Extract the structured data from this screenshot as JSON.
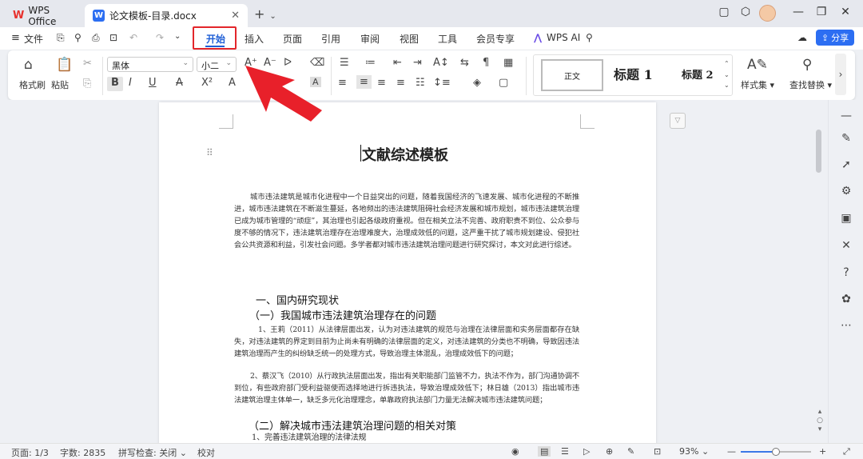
{
  "tabs": {
    "wps_label": "WPS Office",
    "doc_label": "论文模板-目录.docx",
    "new_tab": "+"
  },
  "menu": {
    "file": "文件",
    "items": [
      "开始",
      "插入",
      "页面",
      "引用",
      "审阅",
      "视图",
      "工具",
      "会员专享"
    ],
    "active_index": 0,
    "ai": "WPS AI",
    "share": "分享"
  },
  "ribbon": {
    "format_painter": "格式刷",
    "paste": "粘贴",
    "font_name": "黑体",
    "font_size": "小二",
    "style_normal": "正文",
    "style_h1": "标题 1",
    "style_h2": "标题 2",
    "style_set": "样式集",
    "find_replace": "查找替换"
  },
  "document": {
    "title": "文献综述模板",
    "intro": "城市违法建筑是城市化进程中一个日益突出的问题，随着我国经济的飞速发展、城市化进程的不断推进，城市违法建筑在不断滋生蔓延，各地频出的违法建筑阻碍社会经济发展和城市规划，城市违法建筑治理已成为城市管理的“顽症”，其治理也引起各级政府重视。但在相关立法不完善、政府职责不到位、公众参与度不够的情况下，违法建筑治理存在治理难度大，治理成效低的问题，这严重干扰了城市规划建设、侵犯社会公共资源和利益，引发社会问题。多学者都对城市违法建筑治理问题进行研究探讨，本文对此进行综述。",
    "section1": "一、国内研究现状",
    "sub1": "（一）我国城市违法建筑治理存在的问题",
    "item1": "1、王莉（2011）从法律层面出发，认为对违法建筑的规范与治理在法律层面和实务层面都存在缺失，对违法建筑的界定到目前为止尚未有明确的法律层面的定义，对违法建筑的分类也不明确，导致因违法建筑治理而产生的纠纷缺乏统一的处理方式，导致治理主体混乱，治理成效低下的问题；",
    "item2": "2、蔡汉飞（2010）从行政执法层面出发，指出有关职能部门监管不力，执法不作为，部门沟通协调不到位，有些政府部门受利益驱使而选择地进行拆违执法，导致治理成效低下；林日雄（2013）指出城市违法建筑治理主体单一，缺乏多元化治理理念，单靠政府执法部门力量无法解决城市违法建筑问题；",
    "sub2": "（二）解决城市违法建筑治理问题的相关对策",
    "item3": "1、完善违法建筑治理的法律法规"
  },
  "status": {
    "page": "页面: 1/3",
    "words": "字数: 2835",
    "spell": "拼写检查: 关闭",
    "proof": "校对",
    "zoom": "93%",
    "zoom_fraction": 0.5
  },
  "colors": {
    "accent": "#2c6ef2",
    "highlight": "#e3262b"
  }
}
